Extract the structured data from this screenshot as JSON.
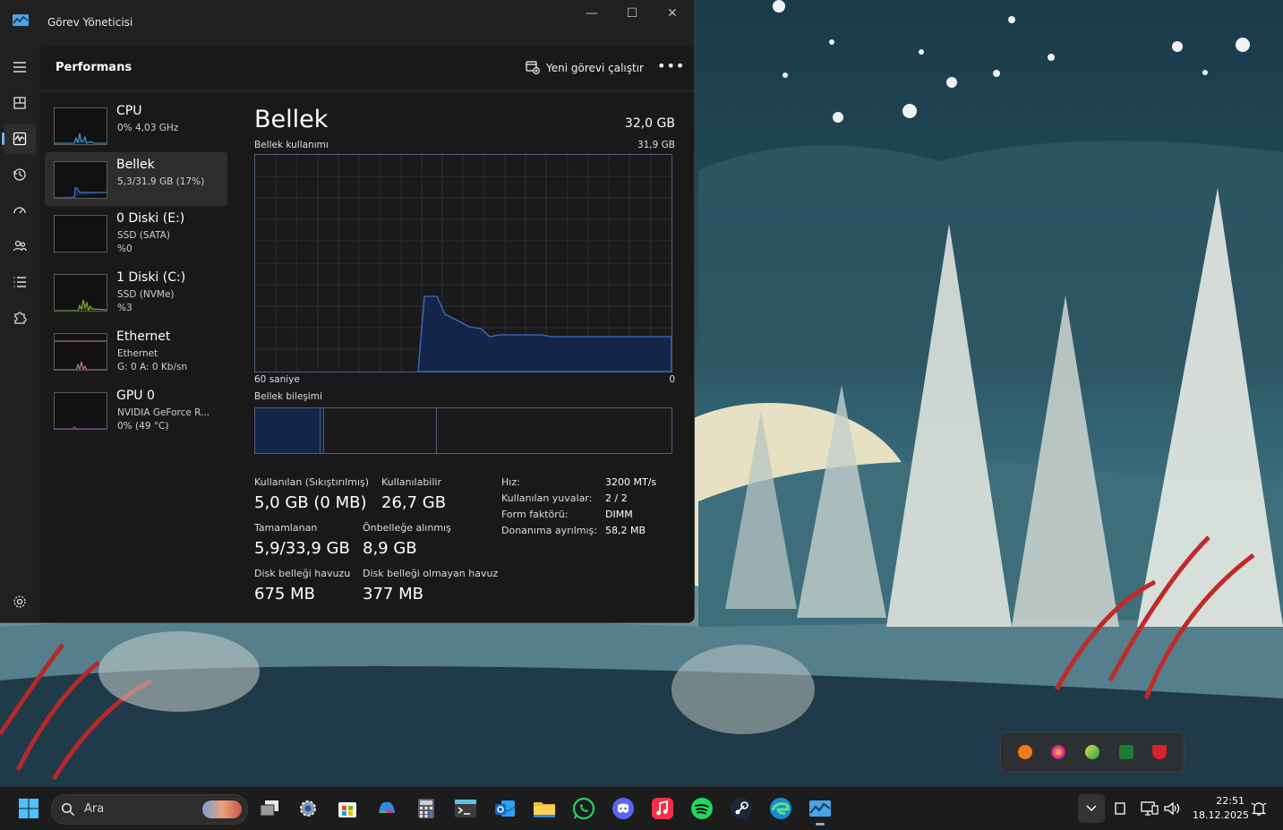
{
  "window": {
    "title": "Görev Yöneticisi",
    "controls": {
      "minimize": "—",
      "maximize": "☐",
      "close": "✕"
    }
  },
  "header": {
    "page_title": "Performans",
    "run_task_label": "Yeni görevi çalıştır",
    "more_label": "•••"
  },
  "resources": [
    {
      "name": "CPU",
      "line1": "0% 4,03 GHz",
      "line2": ""
    },
    {
      "name": "Bellek",
      "line1": "5,3/31,9 GB (17%)",
      "line2": ""
    },
    {
      "name": "0 Diski (E:)",
      "line1": "SSD (SATA)",
      "line2": "%0"
    },
    {
      "name": "1 Diski (C:)",
      "line1": "SSD (NVMe)",
      "line2": "%3"
    },
    {
      "name": "Ethernet",
      "line1": "Ethernet",
      "line2": "G: 0 A: 0 Kb/sn"
    },
    {
      "name": "GPU 0",
      "line1": "NVIDIA GeForce R...",
      "line2": "0% (49 °C)"
    }
  ],
  "detail": {
    "title": "Bellek",
    "total": "32,0 GB",
    "usage_label": "Bellek kullanımı",
    "usage_max": "31,9 GB",
    "axis_left": "60 saniye",
    "axis_right": "0",
    "composition_label": "Bellek bileşimi",
    "stats": {
      "in_use_label": "Kullanılan (Sıkıştırılmış)",
      "in_use_value": "5,0 GB (0 MB)",
      "available_label": "Kullanılabilir",
      "available_value": "26,7 GB",
      "committed_label": "Tamamlanan",
      "committed_value": "5,9/33,9 GB",
      "cached_label": "Önbelleğe alınmış",
      "cached_value": "8,9 GB",
      "paged_label": "Disk belleği havuzu",
      "paged_value": "675 MB",
      "nonpaged_label": "Disk belleği olmayan havuz",
      "nonpaged_value": "377 MB"
    },
    "specs": {
      "speed_label": "Hız:",
      "speed_value": "3200 MT/s",
      "slots_label": "Kullanılan yuvalar:",
      "slots_value": "2 / 2",
      "form_label": "Form faktörü:",
      "form_value": "DIMM",
      "reserved_label": "Donanıma ayrılmış:",
      "reserved_value": "58,2 MB"
    }
  },
  "taskbar": {
    "search_text": "Ara",
    "time": "22:51",
    "date": "18.12.2025"
  },
  "colors": {
    "memory_line": "#3b6ec8",
    "memory_fill": "#13264a",
    "graph_grid": "#2c2c2c",
    "accent": "#6bb4ff"
  }
}
